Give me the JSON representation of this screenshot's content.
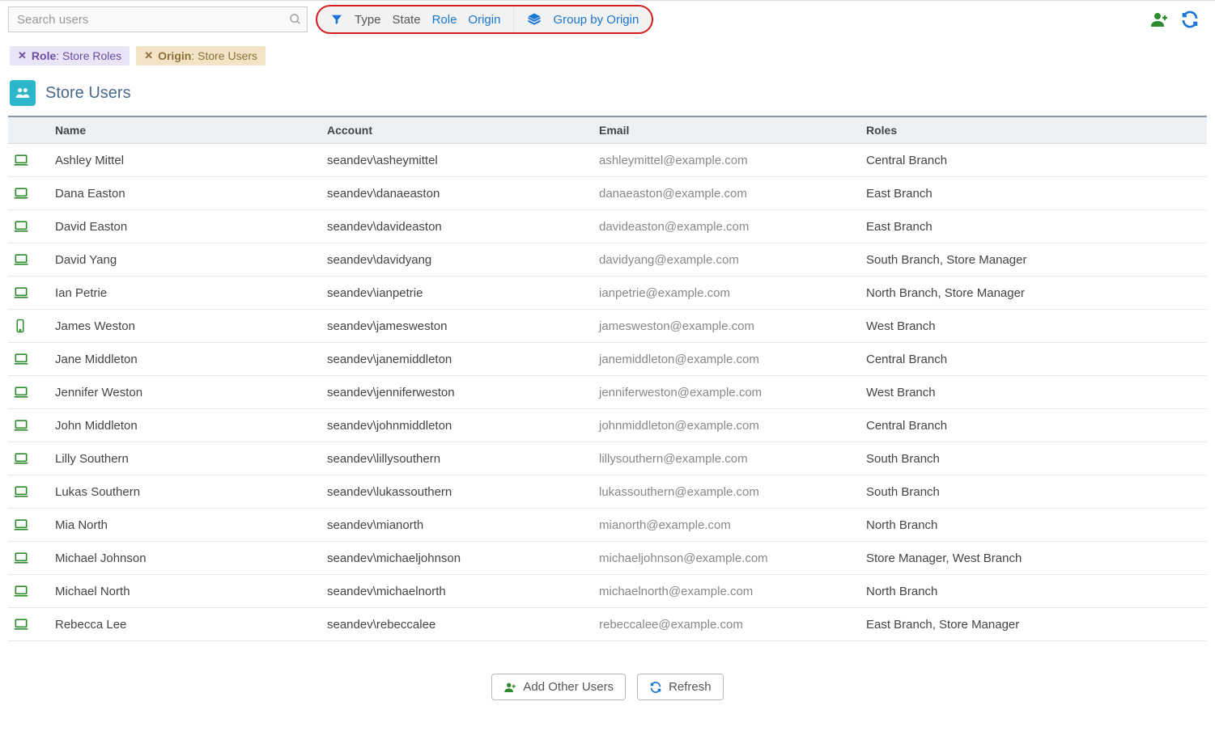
{
  "search": {
    "placeholder": "Search users"
  },
  "filters": {
    "type": "Type",
    "state": "State",
    "role": "Role",
    "origin": "Origin",
    "group_by": "Group by Origin"
  },
  "chips": {
    "role": {
      "label": "Role",
      "value": "Store Roles"
    },
    "origin": {
      "label": "Origin",
      "value": "Store Users"
    }
  },
  "section": {
    "title": "Store Users"
  },
  "table": {
    "headers": {
      "name": "Name",
      "account": "Account",
      "email": "Email",
      "roles": "Roles"
    },
    "rows": [
      {
        "icon": "laptop",
        "name": "Ashley Mittel",
        "account": "seandev\\asheymittel",
        "email": "ashleymittel@example.com",
        "roles": "Central Branch"
      },
      {
        "icon": "laptop",
        "name": "Dana Easton",
        "account": "seandev\\danaeaston",
        "email": "danaeaston@example.com",
        "roles": "East Branch"
      },
      {
        "icon": "laptop",
        "name": "David Easton",
        "account": "seandev\\davideaston",
        "email": "davideaston@example.com",
        "roles": "East Branch"
      },
      {
        "icon": "laptop",
        "name": "David Yang",
        "account": "seandev\\davidyang",
        "email": "davidyang@example.com",
        "roles": "South Branch, Store Manager"
      },
      {
        "icon": "laptop",
        "name": "Ian Petrie",
        "account": "seandev\\ianpetrie",
        "email": "ianpetrie@example.com",
        "roles": "North Branch, Store Manager"
      },
      {
        "icon": "mobile",
        "name": "James Weston",
        "account": "seandev\\jamesweston",
        "email": "jamesweston@example.com",
        "roles": "West Branch"
      },
      {
        "icon": "laptop",
        "name": "Jane Middleton",
        "account": "seandev\\janemiddleton",
        "email": "janemiddleton@example.com",
        "roles": "Central Branch"
      },
      {
        "icon": "laptop",
        "name": "Jennifer Weston",
        "account": "seandev\\jenniferweston",
        "email": "jenniferweston@example.com",
        "roles": "West Branch"
      },
      {
        "icon": "laptop",
        "name": "John Middleton",
        "account": "seandev\\johnmiddleton",
        "email": "johnmiddleton@example.com",
        "roles": "Central Branch"
      },
      {
        "icon": "laptop",
        "name": "Lilly Southern",
        "account": "seandev\\lillysouthern",
        "email": "lillysouthern@example.com",
        "roles": "South Branch"
      },
      {
        "icon": "laptop",
        "name": "Lukas Southern",
        "account": "seandev\\lukassouthern",
        "email": "lukassouthern@example.com",
        "roles": "South Branch"
      },
      {
        "icon": "laptop",
        "name": "Mia North",
        "account": "seandev\\mianorth",
        "email": "mianorth@example.com",
        "roles": "North Branch"
      },
      {
        "icon": "laptop",
        "name": "Michael Johnson",
        "account": "seandev\\michaeljohnson",
        "email": "michaeljohnson@example.com",
        "roles": "Store Manager, West Branch"
      },
      {
        "icon": "laptop",
        "name": "Michael North",
        "account": "seandev\\michaelnorth",
        "email": "michaelnorth@example.com",
        "roles": "North Branch"
      },
      {
        "icon": "laptop",
        "name": "Rebecca Lee",
        "account": "seandev\\rebeccalee",
        "email": "rebeccalee@example.com",
        "roles": "East Branch, Store Manager"
      }
    ]
  },
  "footer": {
    "add_other_users": "Add Other Users",
    "refresh": "Refresh"
  },
  "colors": {
    "green": "#2e8b2e",
    "blue": "#1976d2",
    "teal": "#2cb6c9"
  }
}
